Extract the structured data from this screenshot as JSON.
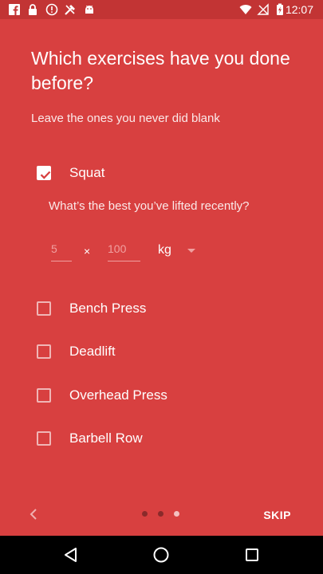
{
  "status_bar": {
    "time": "12:07",
    "left_icons": [
      "facebook-icon",
      "lock-icon",
      "alert-icon",
      "tools-icon",
      "android-icon"
    ],
    "right_icons": [
      "wifi-icon",
      "no-signal-icon",
      "battery-charging-icon"
    ]
  },
  "header": {
    "title": "Which exercises have you done before?",
    "subtitle": "Leave the ones you never did blank"
  },
  "exercises": [
    {
      "label": "Squat",
      "checked": true
    },
    {
      "label": "Bench Press",
      "checked": false
    },
    {
      "label": "Deadlift",
      "checked": false
    },
    {
      "label": "Overhead Press",
      "checked": false
    },
    {
      "label": "Barbell Row",
      "checked": false
    }
  ],
  "squat_detail": {
    "question": "What’s the best you’ve lifted recently?",
    "reps_placeholder": "5",
    "times_symbol": "×",
    "weight_placeholder": "100",
    "unit": "kg"
  },
  "footer": {
    "skip_label": "SKIP",
    "page_count": 3,
    "active_page": 3
  },
  "colors": {
    "background": "#d84040",
    "status_bar": "#c23434",
    "nav_bar": "#000000"
  }
}
